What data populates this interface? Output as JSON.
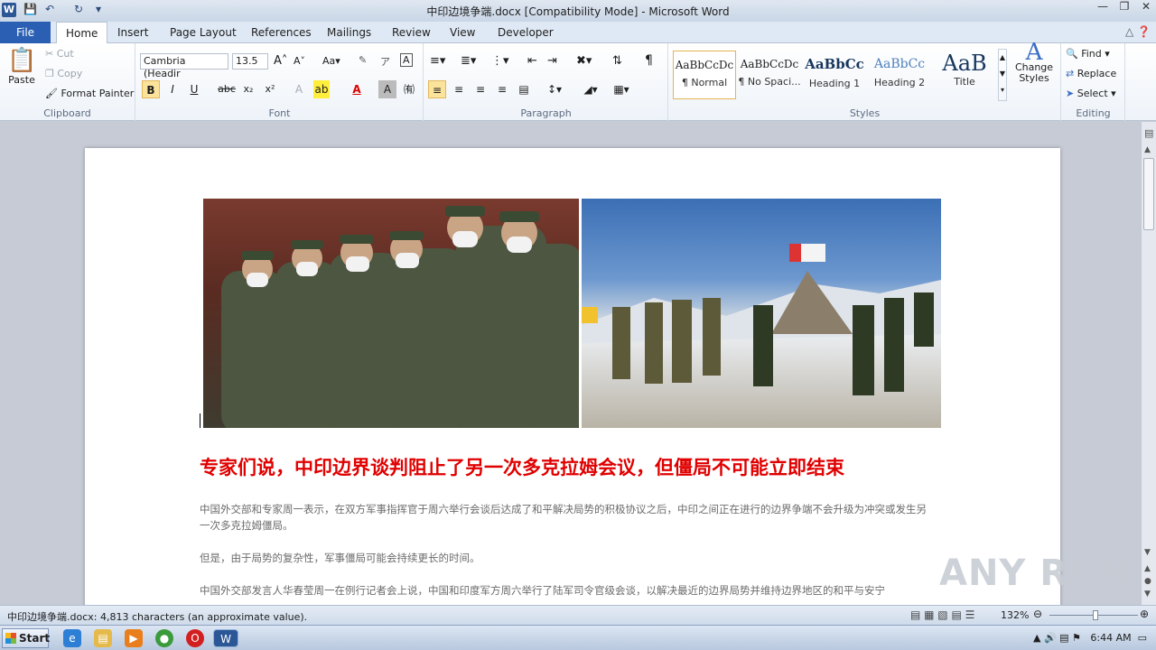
{
  "window": {
    "title": "中印边境争端.docx [Compatibility Mode]  -  Microsoft Word",
    "app_logo": "W"
  },
  "tabs": {
    "file": "File",
    "items": [
      "Home",
      "Insert",
      "Page Layout",
      "References",
      "Mailings",
      "Review",
      "View",
      "Developer"
    ],
    "active": "Home"
  },
  "ribbon": {
    "clipboard": {
      "label": "Clipboard",
      "paste": "Paste",
      "cut": "Cut",
      "copy": "Copy",
      "format_painter": "Format Painter"
    },
    "font": {
      "label": "Font",
      "family": "Cambria (Headir",
      "size": "13.5"
    },
    "paragraph": {
      "label": "Paragraph"
    },
    "styles": {
      "label": "Styles",
      "items": [
        {
          "sample": "AaBbCcDc",
          "name": "¶ Normal"
        },
        {
          "sample": "AaBbCcDc",
          "name": "¶ No Spaci..."
        },
        {
          "sample": "AaBbCc",
          "name": "Heading 1"
        },
        {
          "sample": "AaBbCc",
          "name": "Heading 2"
        },
        {
          "sample": "AaB",
          "name": "Title"
        }
      ],
      "change_styles": "Change Styles"
    },
    "editing": {
      "label": "Editing",
      "find": "Find",
      "replace": "Replace",
      "select": "Select"
    }
  },
  "document": {
    "headline": "专家们说，中印边界谈判阻止了另一次多克拉姆会议，但僵局不可能立即结束",
    "paragraphs": [
      "中国外交部和专家周一表示，在双方军事指挥官于周六举行会谈后达成了和平解决局势的积极协议之后，中印之间正在进行的边界争端不会升级为冲突或发生另一次多克拉姆僵局。",
      "但是，由于局势的复杂性，军事僵局可能会持续更长的时间。",
      "中国外交部发言人华春莹周一在例行记者会上说，中国和印度军方周六举行了陆军司令官级会谈，以解决最近的边界局势并维持边界地区的和平与安宁"
    ]
  },
  "statusbar": {
    "text": "中印边境争端.docx: 4,813 characters (an approximate value).",
    "zoom": "132%"
  },
  "taskbar": {
    "start": "Start",
    "clock": "6:44 AM"
  },
  "watermark": "ANY RUN"
}
